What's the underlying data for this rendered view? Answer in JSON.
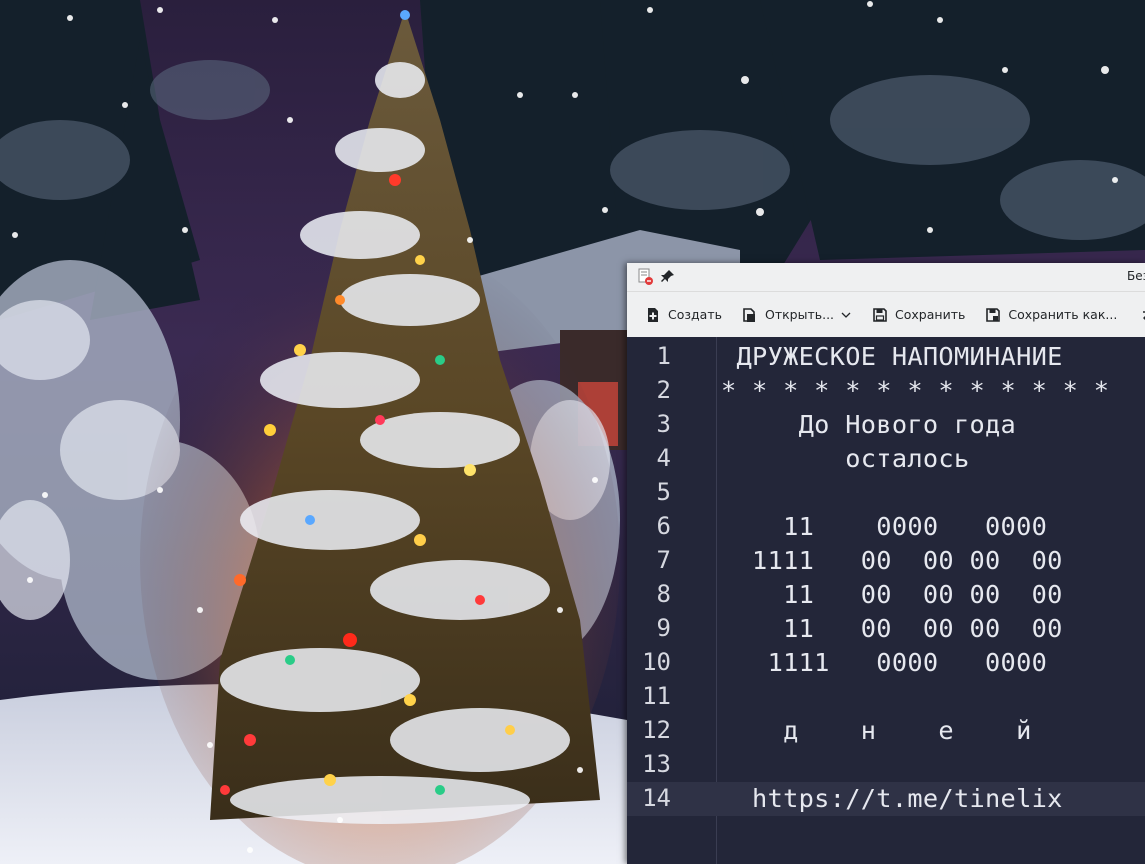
{
  "window": {
    "title": "Без",
    "toolbar": {
      "new_label": "Создать",
      "open_label": "Открыть...",
      "save_label": "Сохранить",
      "save_as_label": "Сохранить как..."
    }
  },
  "editor": {
    "current_line": 14,
    "lines": [
      {
        "num": "1",
        "text": " ДРУЖЕСКОЕ НАПОМИНАНИЕ"
      },
      {
        "num": "2",
        "text": "* * * * * * * * * * * * *"
      },
      {
        "num": "3",
        "text": "     До Нового года"
      },
      {
        "num": "4",
        "text": "        осталось"
      },
      {
        "num": "5",
        "text": ""
      },
      {
        "num": "6",
        "text": "    11    0000   0000"
      },
      {
        "num": "7",
        "text": "  1111   00  00 00  00"
      },
      {
        "num": "8",
        "text": "    11   00  00 00  00"
      },
      {
        "num": "9",
        "text": "    11   00  00 00  00"
      },
      {
        "num": "10",
        "text": "   1111   0000   0000"
      },
      {
        "num": "11",
        "text": ""
      },
      {
        "num": "12",
        "text": "    д    н    е    й"
      },
      {
        "num": "13",
        "text": ""
      },
      {
        "num": "14",
        "text": "  https://t.me/tinelix"
      }
    ]
  },
  "colors": {
    "editor_bg": "#232639",
    "text": "#e6e8ef",
    "toolbar_bg": "#eff0f1",
    "current_line_bg": "#2f3246"
  },
  "icons": {
    "app": "notepad-app-icon",
    "pin": "pin-icon",
    "new": "new-document-icon",
    "open": "open-document-icon",
    "save": "save-icon",
    "save_as": "save-as-icon"
  }
}
